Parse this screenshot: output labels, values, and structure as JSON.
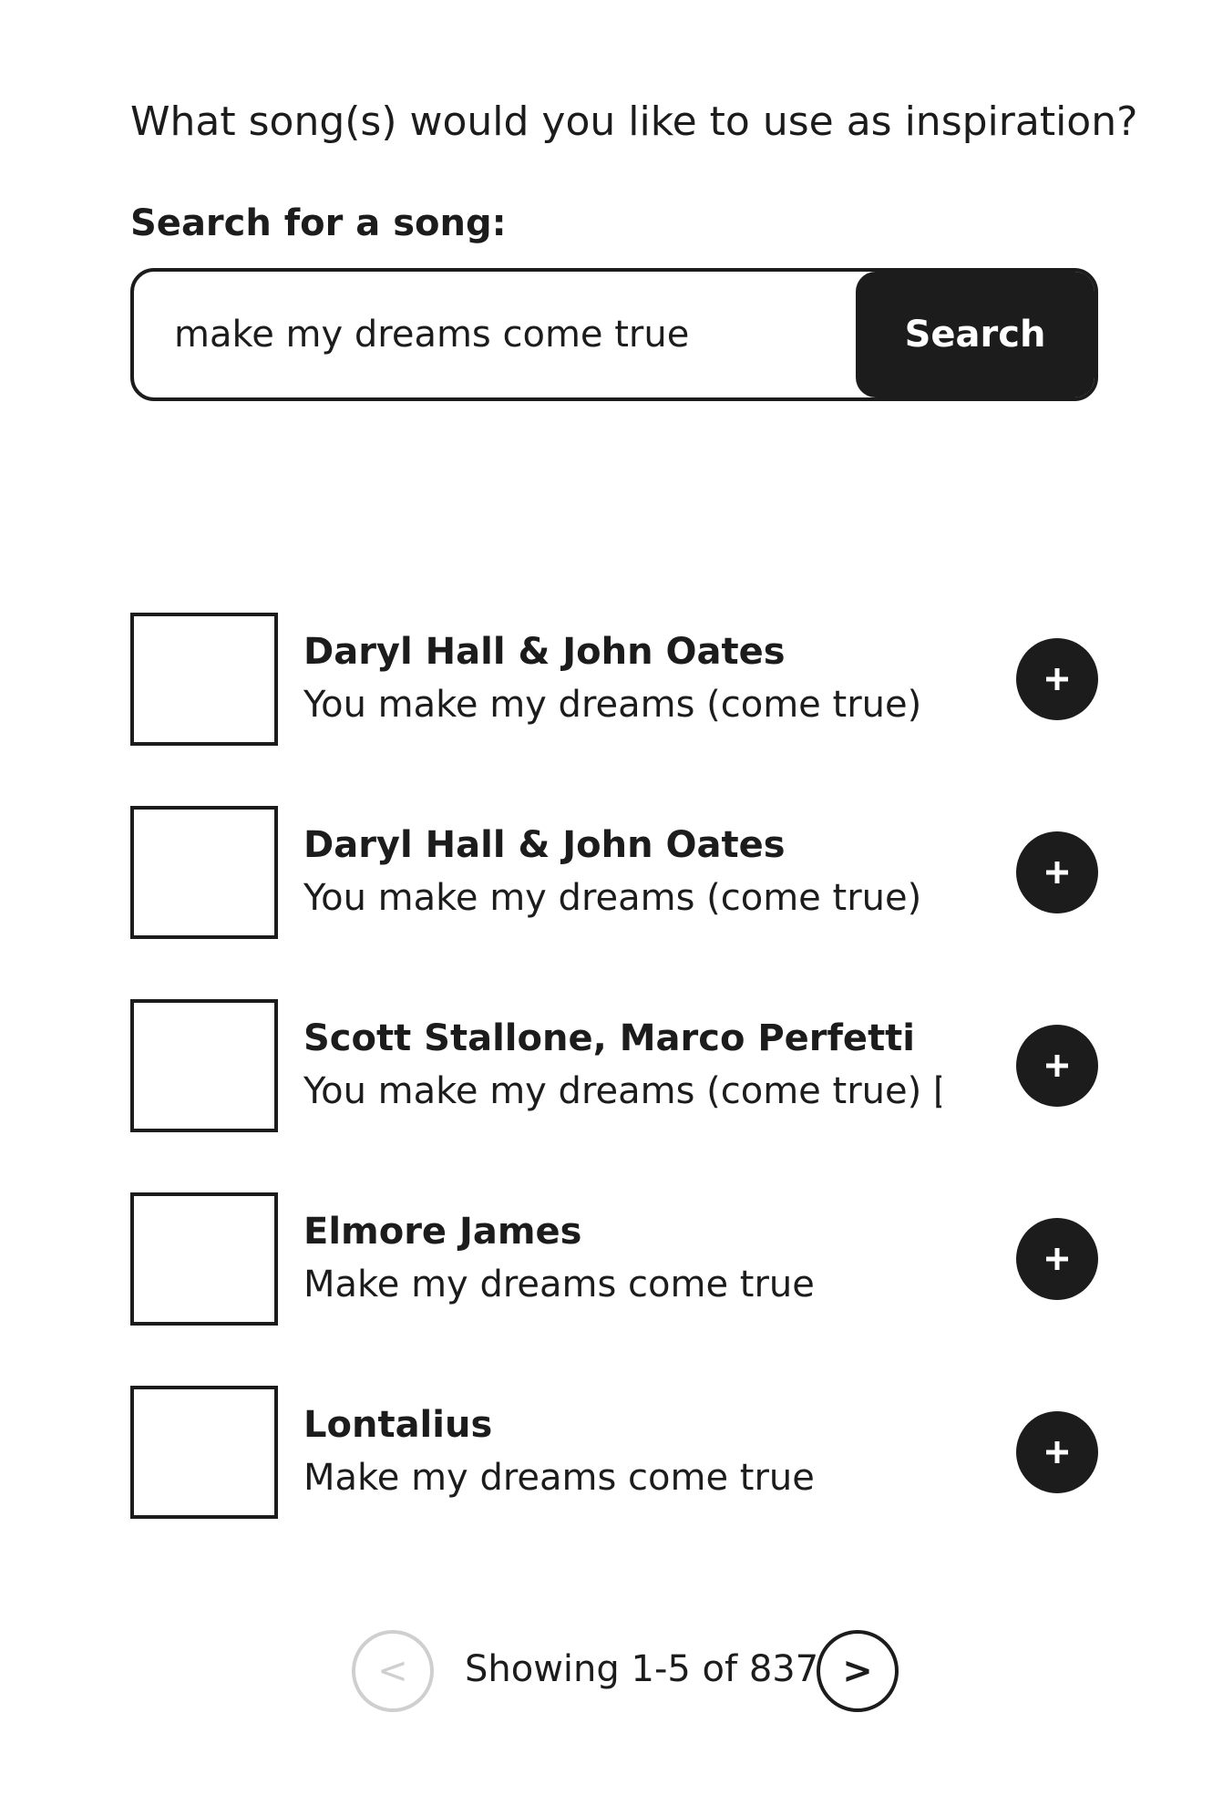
{
  "question": "What song(s) would you like to use as inspiration?",
  "search": {
    "label": "Search for a song:",
    "value": "make my dreams come true",
    "button_label": "Search"
  },
  "results": [
    {
      "artist": "Daryl Hall & John Oates",
      "title": "You make my dreams (come true)",
      "add_icon": "plus-icon"
    },
    {
      "artist": "Daryl Hall & John Oates",
      "title": "You make my dreams (come true)",
      "add_icon": "plus-icon"
    },
    {
      "artist": "Scott Stallone, Marco Perfetti",
      "title": "You make my dreams (come true) [I...",
      "add_icon": "plus-icon"
    },
    {
      "artist": "Elmore James",
      "title": "Make my dreams come true",
      "add_icon": "plus-icon"
    },
    {
      "artist": "Lontalius",
      "title": "Make my dreams come true",
      "add_icon": "plus-icon"
    }
  ],
  "pagination": {
    "prev_label": "<",
    "next_label": ">",
    "info": "Showing 1-5 of 837"
  },
  "colors": {
    "primary": "#1c1c1c",
    "disabled": "#cfcfcf",
    "background": "#ffffff"
  }
}
